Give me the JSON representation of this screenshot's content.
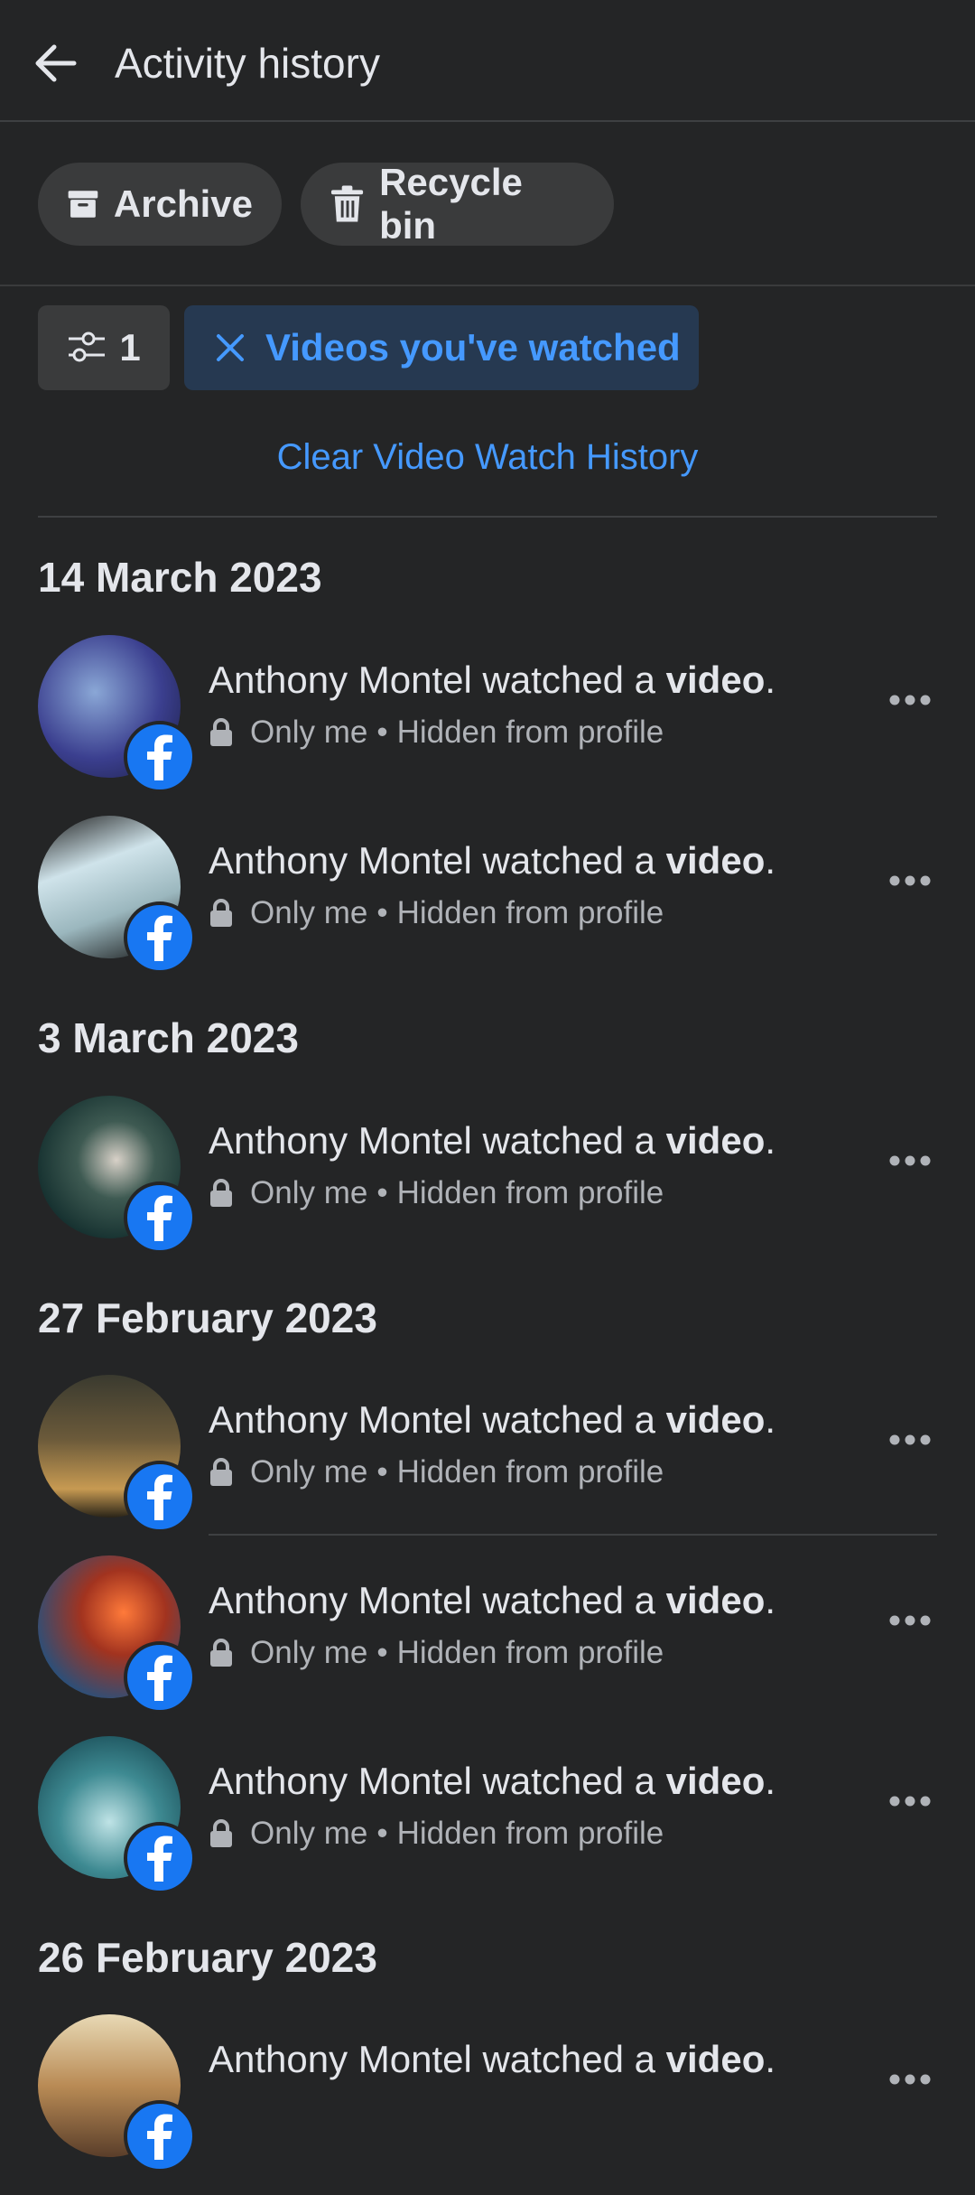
{
  "header": {
    "title": "Activity history"
  },
  "buttons": {
    "archive_label": "Archive",
    "recycle_label": "Recycle bin"
  },
  "filters": {
    "count": "1",
    "active_filter": "Videos you've watched"
  },
  "clear_link": "Clear Video Watch History",
  "sections": [
    {
      "date": "14 March 2023",
      "items": [
        {
          "actor": "Anthony Montel watched a ",
          "object": "video",
          "end": ".",
          "privacy": "Only me",
          "sep": "•",
          "visibility": "Hidden from profile"
        },
        {
          "actor": "Anthony Montel watched a ",
          "object": "video",
          "end": ".",
          "privacy": "Only me",
          "sep": "•",
          "visibility": "Hidden from profile"
        }
      ]
    },
    {
      "date": "3 March 2023",
      "items": [
        {
          "actor": "Anthony Montel watched a ",
          "object": "video",
          "end": ".",
          "privacy": "Only me",
          "sep": "•",
          "visibility": "Hidden from profile"
        }
      ]
    },
    {
      "date": "27 February 2023",
      "items": [
        {
          "actor": "Anthony Montel watched a ",
          "object": "video",
          "end": ".",
          "privacy": "Only me",
          "sep": "•",
          "visibility": "Hidden from profile"
        },
        {
          "actor": "Anthony Montel watched a ",
          "object": "video",
          "end": ".",
          "privacy": "Only me",
          "sep": "•",
          "visibility": "Hidden from profile"
        },
        {
          "actor": "Anthony Montel watched a ",
          "object": "video",
          "end": ".",
          "privacy": "Only me",
          "sep": "•",
          "visibility": "Hidden from profile"
        }
      ]
    },
    {
      "date": "26 February 2023",
      "items": [
        {
          "actor": "Anthony Montel watched a ",
          "object": "video",
          "end": ".",
          "privacy": "",
          "sep": "",
          "visibility": ""
        }
      ]
    }
  ],
  "colors": {
    "background": "#242526",
    "accent": "#4599ff",
    "facebook_blue": "#1877f2",
    "chip_bg": "#263951"
  },
  "icons": {
    "back": "arrow-left-icon",
    "archive": "archive-box-icon",
    "recycle": "trash-icon",
    "filter": "sliders-icon",
    "clear_filter": "close-icon",
    "privacy": "lock-icon",
    "more": "more-horizontal-icon",
    "badge": "facebook-logo-icon"
  }
}
